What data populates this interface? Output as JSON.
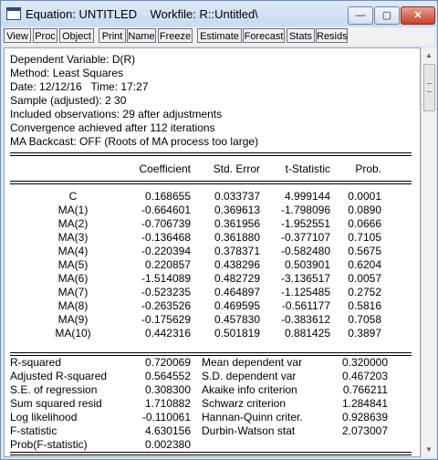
{
  "window": {
    "title": "Equation: UNTITLED    Workfile: R::Untitled\\",
    "min_label": "—",
    "max_label": "▢",
    "close_label": "✕"
  },
  "toolbar": [
    "View",
    "Proc",
    "Object",
    "Print",
    "Name",
    "Freeze",
    "Estimate",
    "Forecast",
    "Stats",
    "Resids"
  ],
  "header": [
    "Dependent Variable: D(R)",
    "Method: Least Squares",
    "Date: 12/12/16   Time: 17:27",
    "Sample (adjusted): 2 30",
    "Included observations: 29 after adjustments",
    "Convergence achieved after 112 iterations",
    "MA Backcast: OFF (Roots of MA process too large)"
  ],
  "table": {
    "columns": [
      "Coefficient",
      "Std. Error",
      "t-Statistic",
      "Prob."
    ],
    "rows": [
      {
        "var": "C",
        "coef": "0.168655",
        "se": "0.033737",
        "t": "4.999144",
        "p": "0.0001"
      },
      {
        "var": "MA(1)",
        "coef": "-0.664601",
        "se": "0.369613",
        "t": "-1.798096",
        "p": "0.0890"
      },
      {
        "var": "MA(2)",
        "coef": "-0.706739",
        "se": "0.361956",
        "t": "-1.952551",
        "p": "0.0666"
      },
      {
        "var": "MA(3)",
        "coef": "-0.136468",
        "se": "0.361880",
        "t": "-0.377107",
        "p": "0.7105"
      },
      {
        "var": "MA(4)",
        "coef": "-0.220394",
        "se": "0.378371",
        "t": "-0.582480",
        "p": "0.5675"
      },
      {
        "var": "MA(5)",
        "coef": "0.220857",
        "se": "0.438296",
        "t": "0.503901",
        "p": "0.6204"
      },
      {
        "var": "MA(6)",
        "coef": "-1.514089",
        "se": "0.482729",
        "t": "-3.136517",
        "p": "0.0057"
      },
      {
        "var": "MA(7)",
        "coef": "-0.523235",
        "se": "0.464897",
        "t": "-1.125485",
        "p": "0.2752"
      },
      {
        "var": "MA(8)",
        "coef": "-0.263526",
        "se": "0.469595",
        "t": "-0.561177",
        "p": "0.5816"
      },
      {
        "var": "MA(9)",
        "coef": "-0.175629",
        "se": "0.457830",
        "t": "-0.383612",
        "p": "0.7058"
      },
      {
        "var": "MA(10)",
        "coef": "0.442316",
        "se": "0.501819",
        "t": "0.881425",
        "p": "0.3897"
      }
    ]
  },
  "stats": [
    {
      "l": "R-squared",
      "lv": "0.720069",
      "r": "Mean dependent var",
      "rv": "0.320000"
    },
    {
      "l": "Adjusted R-squared",
      "lv": "0.564552",
      "r": "S.D. dependent var",
      "rv": "0.467203"
    },
    {
      "l": "S.E. of regression",
      "lv": "0.308300",
      "r": "Akaike info criterion",
      "rv": "0.766211"
    },
    {
      "l": "Sum squared resid",
      "lv": "1.710882",
      "r": "Schwarz criterion",
      "rv": "1.284841"
    },
    {
      "l": "Log likelihood",
      "lv": "-0.110061",
      "r": "Hannan-Quinn criter.",
      "rv": "0.928639"
    },
    {
      "l": "F-statistic",
      "lv": "4.630156",
      "r": "Durbin-Watson stat",
      "rv": "2.073007"
    },
    {
      "l": "Prob(F-statistic)",
      "lv": "0.002380",
      "r": "",
      "rv": ""
    }
  ],
  "scrollbar": {
    "up": "▲",
    "down": "▼"
  }
}
